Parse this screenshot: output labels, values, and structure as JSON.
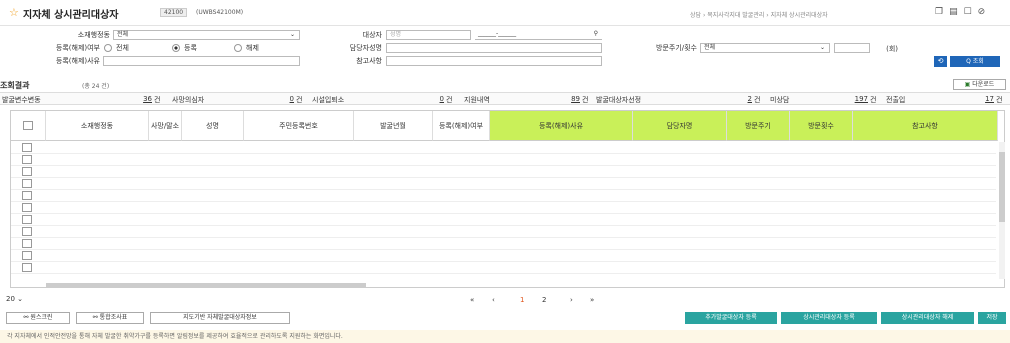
{
  "header": {
    "title": "지자체 상시관리대상자",
    "code": "42100",
    "code_full": "(UWBS42100M)",
    "breadcrumb": "상담 › 복지사각지대 발굴관리 › 지자체 상시관리대상자",
    "icons": [
      "favorite-icon",
      "print-icon",
      "window-icon",
      "help-icon"
    ]
  },
  "form": {
    "region_label": "소재행정동",
    "region_value": "전체",
    "target_label": "대상자",
    "target_placeholder": "성명",
    "target_id_value": "______-______",
    "reg_status_label": "등록(해제)여부",
    "reg_options": [
      "전체",
      "등록",
      "해제"
    ],
    "reg_selected": "등록",
    "manager_label": "담당자성명",
    "manager_value": "",
    "visit_label": "방문주기/횟수",
    "visit_value": "전체",
    "visit_count_value": "",
    "visit_unit": "(회)",
    "reason_label": "등록(해제)사유",
    "reason_value": "",
    "note_label": "참고사항",
    "note_value": "",
    "reset_label": "⟲",
    "search_label": "Q 조회"
  },
  "result": {
    "title": "조회결과",
    "count": "(총 24 건)",
    "download": "다운로드"
  },
  "stats": [
    {
      "label": "발굴변수변동",
      "value": "36",
      "unit": "건"
    },
    {
      "label": "사망의심자",
      "value": "0",
      "unit": "건"
    },
    {
      "label": "시설입퇴소",
      "value": "0",
      "unit": "건"
    },
    {
      "label": "지원내역",
      "value": "89",
      "unit": "건"
    },
    {
      "label": "발굴대상자선정",
      "value": "2",
      "unit": "건"
    },
    {
      "label": "미상담",
      "value": "197",
      "unit": "건"
    },
    {
      "label": "전출입",
      "value": "17",
      "unit": "건"
    }
  ],
  "grid": {
    "columns": [
      "소재행정동",
      "사망/말소",
      "성명",
      "주민등록번호",
      "발굴년월",
      "등록(해제)여부",
      "등록(해제)사유",
      "담당자명",
      "방문주기",
      "방문횟수",
      "참고사항"
    ]
  },
  "pager": {
    "page_size": "20",
    "first": "«",
    "prev": "‹",
    "pages": [
      "1",
      "2"
    ],
    "current": "1",
    "next": "›",
    "last": "»"
  },
  "buttons": {
    "screen": "원스크린",
    "integrated": "통합조사표",
    "map": "지도기반 자체발굴대상자정보",
    "add": "추가발굴대상자 등록",
    "register": "상시관리대상자 등록",
    "release": "상시관리대상자 해제",
    "save": "저장"
  },
  "footer": "각 지자체에서 인적안전망을 통해 자체 발굴한 취약가구를 등록하면 알림정보를 제공하여 효율적으로 관리하도록 지원하는 화면입니다.",
  "colors": {
    "accent": "#1f66b8",
    "header_green": "#c9f059",
    "action_teal": "#2aa4a0"
  }
}
